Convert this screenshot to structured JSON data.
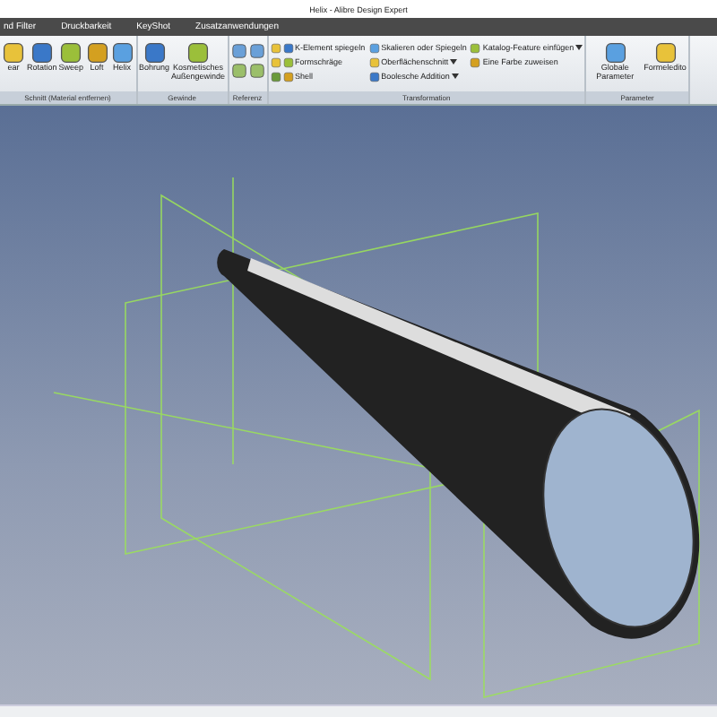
{
  "window": {
    "title": "Helix - Alibre Design Expert"
  },
  "menu_tabs": [
    {
      "label": "nd Filter",
      "selected": false
    },
    {
      "label": "Druckbarkeit",
      "selected": false
    },
    {
      "label": "KeyShot",
      "selected": false
    },
    {
      "label": "Zusatzanwendungen",
      "selected": false
    }
  ],
  "ribbon_groups": [
    {
      "label": "Schnitt (Material entfernen)",
      "items": [
        {
          "kind": "large",
          "label": "ear"
        },
        {
          "kind": "large",
          "label": "Rotation"
        },
        {
          "kind": "large",
          "label": "Sweep"
        },
        {
          "kind": "large",
          "label": "Loft"
        },
        {
          "kind": "large",
          "label": "Helix"
        }
      ]
    },
    {
      "label": "Gewinde",
      "items": [
        {
          "kind": "large",
          "label": "Bohrung"
        },
        {
          "kind": "large",
          "label": "Kosmetisches Außengewinde"
        }
      ]
    },
    {
      "label": "Referenz",
      "items": [
        {
          "kind": "iconpair"
        },
        {
          "kind": "iconpair"
        }
      ]
    },
    {
      "label": "Transformation",
      "items": [
        {
          "kind": "iconcol"
        },
        {
          "kind": "small",
          "label": "K-Element spiegeln",
          "dropdown": false
        },
        {
          "kind": "small",
          "label": "Formschräge",
          "dropdown": false
        },
        {
          "kind": "small",
          "label": "Shell",
          "dropdown": false
        },
        {
          "kind": "small",
          "label": "Skalieren oder Spiegeln",
          "dropdown": false
        },
        {
          "kind": "small",
          "label": "Oberflächenschnitt",
          "dropdown": true
        },
        {
          "kind": "small",
          "label": "Boolesche Addition",
          "dropdown": true
        },
        {
          "kind": "small",
          "label": "Katalog-Feature einfügen",
          "dropdown": true
        },
        {
          "kind": "small",
          "label": "Eine Farbe zuweisen",
          "dropdown": false
        }
      ]
    },
    {
      "label": "Parameter",
      "items": [
        {
          "kind": "large",
          "label": "Globale Parameter"
        },
        {
          "kind": "large",
          "label": "Formeledito"
        }
      ]
    }
  ]
}
